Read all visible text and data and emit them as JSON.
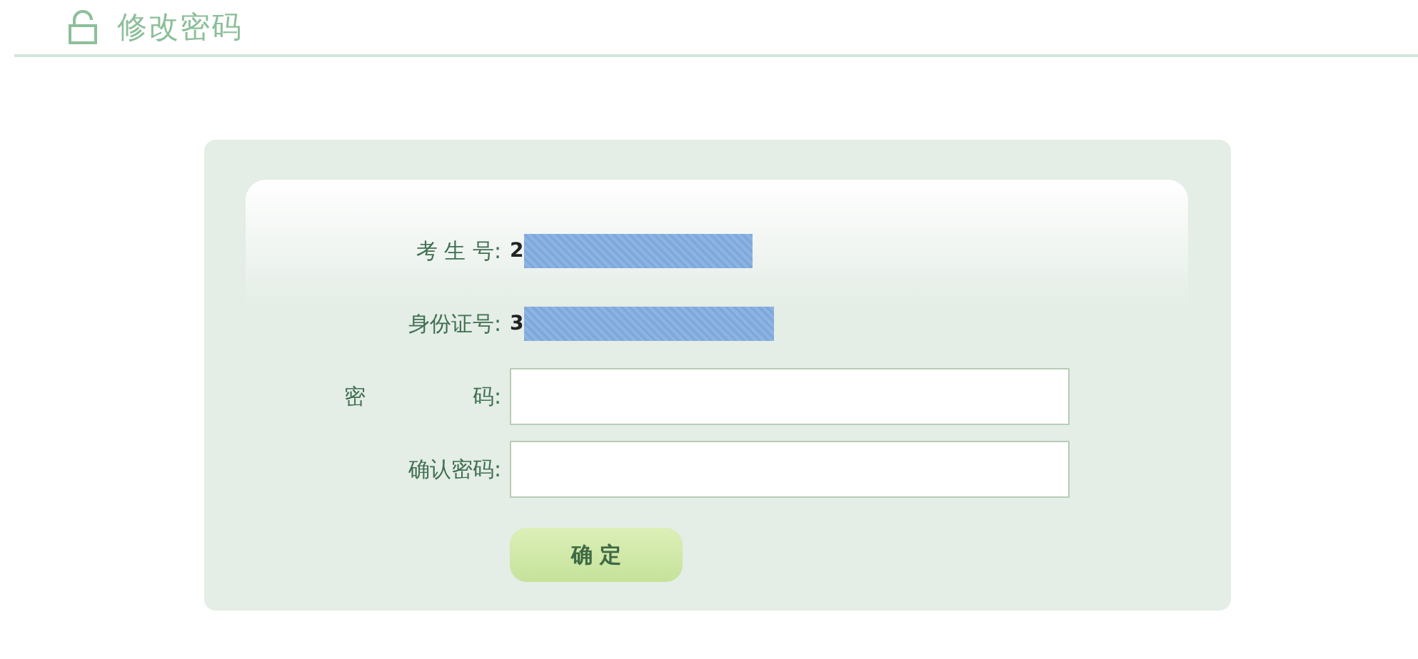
{
  "header": {
    "title": "修改密码"
  },
  "form": {
    "rows": [
      {
        "kind": "info",
        "label": "考 生 号:",
        "value": "2"
      },
      {
        "kind": "info",
        "label": "身份证号:",
        "value": "3"
      },
      {
        "kind": "input",
        "label": "密　　　　　码:"
      },
      {
        "kind": "input",
        "label": "确认密码:"
      }
    ],
    "submit": "确 定"
  }
}
